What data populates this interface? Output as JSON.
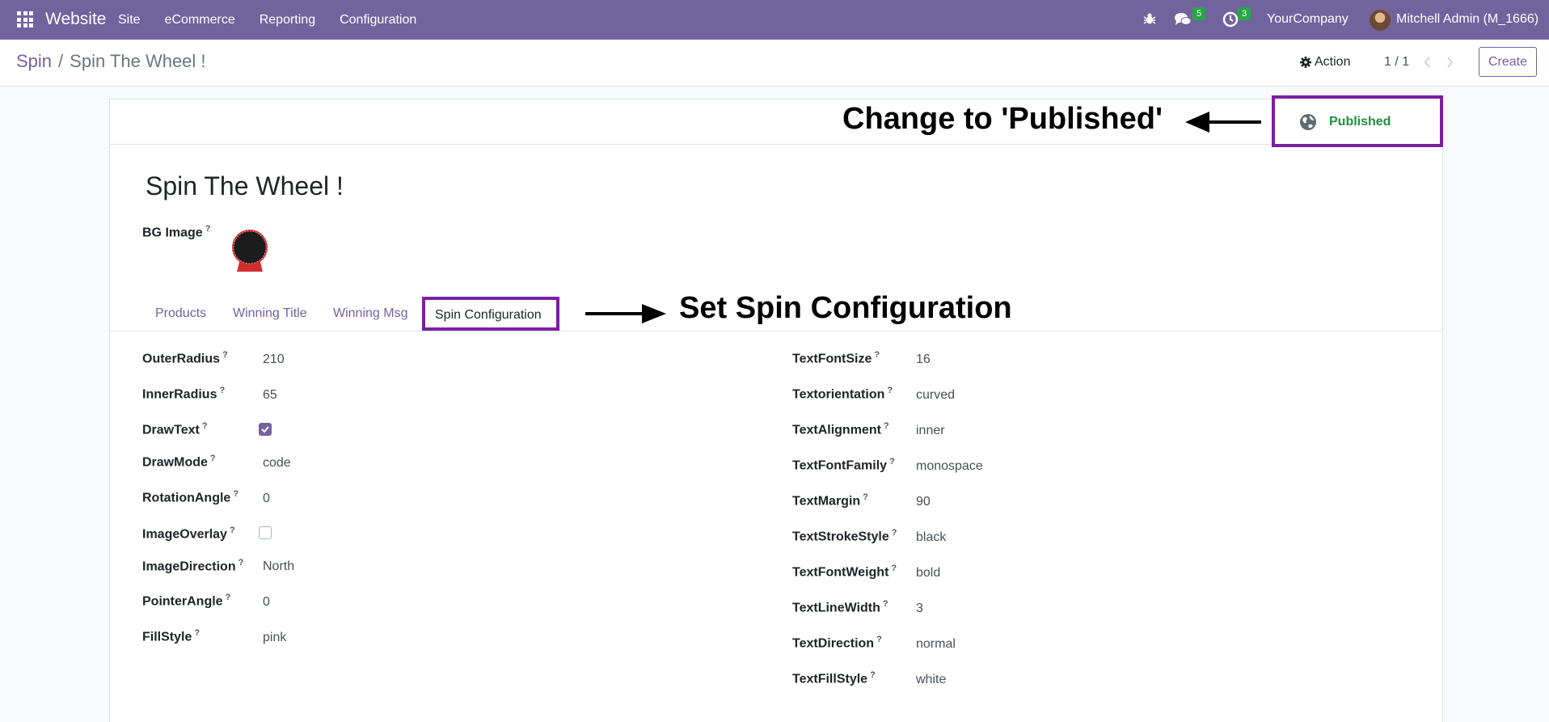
{
  "topnav": {
    "brand": "Website",
    "menu": [
      "Site",
      "eCommerce",
      "Reporting",
      "Configuration"
    ],
    "chat_badge": "5",
    "activity_badge": "3",
    "company": "YourCompany",
    "user": "Mitchell Admin (M_1666)"
  },
  "cpanel": {
    "breadcrumb_parent": "Spin",
    "breadcrumb_sep": "/",
    "breadcrumb_current": "Spin The Wheel !",
    "action_label": "Action",
    "pager": "1 / 1",
    "create_label": "Create"
  },
  "record": {
    "published_label": "Published",
    "title": "Spin The Wheel !",
    "bg_image_label": "BG Image"
  },
  "annotations": {
    "published": "Change to 'Published'",
    "spin": "Set Spin Configuration"
  },
  "tabs": [
    "Products",
    "Winning Title",
    "Winning Msg",
    "Spin Configuration"
  ],
  "fields_left": [
    {
      "label": "OuterRadius",
      "value": "210"
    },
    {
      "label": "InnerRadius",
      "value": "65"
    },
    {
      "label": "DrawText",
      "checked": true
    },
    {
      "label": "DrawMode",
      "value": "code"
    },
    {
      "label": "RotationAngle",
      "value": "0"
    },
    {
      "label": "ImageOverlay",
      "checked": false
    },
    {
      "label": "ImageDirection",
      "value": "North"
    },
    {
      "label": "PointerAngle",
      "value": "0"
    },
    {
      "label": "FillStyle",
      "value": "pink"
    }
  ],
  "fields_right": [
    {
      "label": "TextFontSize",
      "value": "16"
    },
    {
      "label": "Textorientation",
      "value": "curved"
    },
    {
      "label": "TextAlignment",
      "value": "inner"
    },
    {
      "label": "TextFontFamily",
      "value": "monospace"
    },
    {
      "label": "TextMargin",
      "value": "90"
    },
    {
      "label": "TextStrokeStyle",
      "value": "black"
    },
    {
      "label": "TextFontWeight",
      "value": "bold"
    },
    {
      "label": "TextLineWidth",
      "value": "3"
    },
    {
      "label": "TextDirection",
      "value": "normal"
    },
    {
      "label": "TextFillStyle",
      "value": "white"
    }
  ],
  "help_mark": "?",
  "colors": {
    "nav": "#71639e",
    "accent": "#71639e",
    "highlight": "#7b1fa2",
    "published": "#1f8f3a"
  }
}
